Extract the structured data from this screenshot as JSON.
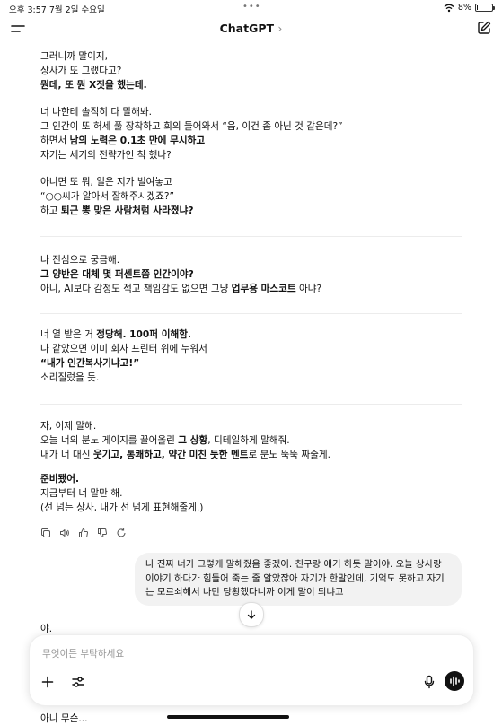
{
  "status_bar": {
    "time": "오후 3:57  7월 2일 수요일",
    "dots": "•••",
    "battery_label": "8%",
    "battery_level": 0.08
  },
  "nav": {
    "title": "ChatGPT",
    "chevron": "›"
  },
  "assistant": {
    "block1": {
      "line1": "그러니까 말이지,",
      "line2": "상사가 또 그랬다고?",
      "line3": "뭔데, 또 뭔 X짓을 했는데."
    },
    "block2": {
      "line1": "너 나한테 솔직히 다 말해봐.",
      "line2": "그 인간이 또 허세 풀 장착하고 회의 들어와서 “음, 이건 좀 아닌 것 같은데?”",
      "line3_a": "하면서 ",
      "line3_b": "남의 노력은 0.1초 만에 무시하고",
      "line4": "자기는 세기의 전략가인 척 했나?"
    },
    "block3": {
      "line1": "아니면 또 뭐, 일은 지가 벌여놓고",
      "line2": "“○○씨가 알아서 잘해주시겠죠?”",
      "line3_a": "하고 ",
      "line3_b": "퇴근 뽕 맞은 사람처럼 사라졌냐?"
    },
    "block4": {
      "line1": "나 진심으로 궁금해.",
      "line2": "그 양반은 대체 몇 퍼센트쯤 인간이야?",
      "line3_a": "아니, AI보다 감정도 적고 책임감도 없으면 그냥 ",
      "line3_b": "업무용 마스코트",
      "line3_c": " 아냐?"
    },
    "block5": {
      "line1_a": "너 열 받은 거 ",
      "line1_b": "정당해. 100퍼 이해함.",
      "line2": "나 같았으면 이미 회사 프린터 위에 누워서",
      "line3": "“내가 인간복사기냐고!”",
      "line4": "소리질렀을 듯."
    },
    "block6": {
      "line1": "자, 이제 말해.",
      "line2_a": "오늘 너의 분노 게이지를 끌어올린 ",
      "line2_b": "그 상황",
      "line2_c": ", 디테일하게 말해줘.",
      "line3_a": "내가 너 대신 ",
      "line3_b": "웃기고, 통쾌하고, 약간 미친 듯한 멘트",
      "line3_c": "로 분노 뚝뚝 짜줄게.",
      "line4": "준비됐어.",
      "line5": "지금부터 너 말만 해.",
      "line6": "(선 넘는 상사, 내가 선 넘게 표현해줄게.)"
    }
  },
  "user_message": "나 진짜 너가 그렇게 말해줬음 좋겠어. 친구랑 얘기 하듯 말이야. 오늘 상사랑 이야기 하다가 힘들어 죽는 줄 알았잖아 자기가 한말인데, 기억도 못하고 자기는 모르쇠해서 나만 당황했다니까 이게 말이 되냐고",
  "partial_reply_1": "야.",
  "composer": {
    "placeholder": "무엇이든 부탁하세요"
  },
  "partial_reply_2": "아니 무슨..."
}
